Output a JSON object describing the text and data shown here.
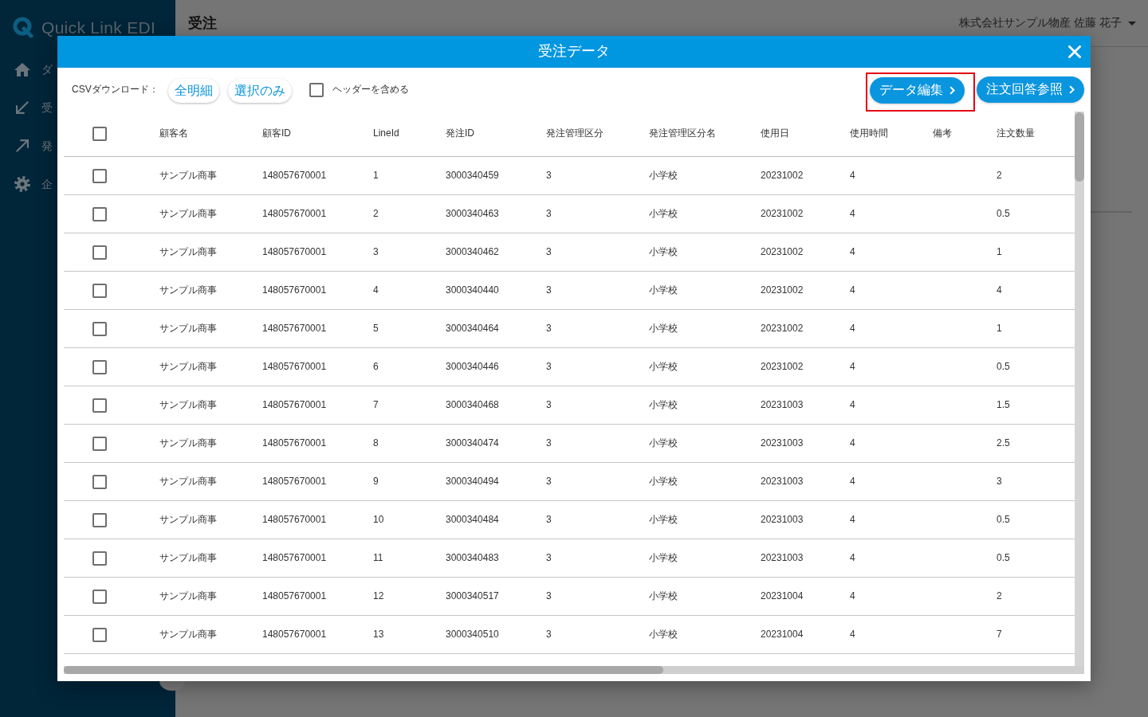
{
  "sidebar": {
    "logo": "Quick Link EDI",
    "items": [
      {
        "kind": "home",
        "label": "ダ"
      },
      {
        "kind": "inbound",
        "label": "受"
      },
      {
        "kind": "outbound",
        "label": "発"
      },
      {
        "kind": "settings",
        "label": "企"
      }
    ]
  },
  "header": {
    "title": "受注",
    "user": "株式会社サンプル物産 佐藤 花子"
  },
  "dialog": {
    "title": "受注データ",
    "csv_download": {
      "label": "CSVダウンロード：",
      "buttons": [
        "全明細",
        "選択のみ"
      ],
      "include_header": {
        "label": "ヘッダーを含める",
        "checked": false
      }
    },
    "actions": [
      {
        "label": "データ編集",
        "highlighted": true
      },
      {
        "label": "注文回答参照",
        "highlighted": false
      }
    ],
    "table": {
      "select_all_checked": false,
      "columns": [
        "顧客名",
        "顧客ID",
        "LineId",
        "発注ID",
        "発注管理区分",
        "発注管理区分名",
        "使用日",
        "使用時間",
        "備考",
        "注文数量"
      ],
      "rows": [
        {
          "selected": false,
          "customer_name": "サンプル商事",
          "customer_id": "148057670001",
          "line_id": "1",
          "order_id": "3000340459",
          "order_class": "3",
          "order_class_name": "小学校",
          "use_date": "20231002",
          "use_time": "4",
          "quantity": "2"
        },
        {
          "selected": false,
          "customer_name": "サンプル商事",
          "customer_id": "148057670001",
          "line_id": "2",
          "order_id": "3000340463",
          "order_class": "3",
          "order_class_name": "小学校",
          "use_date": "20231002",
          "use_time": "4",
          "quantity": "0.5"
        },
        {
          "selected": false,
          "customer_name": "サンプル商事",
          "customer_id": "148057670001",
          "line_id": "3",
          "order_id": "3000340462",
          "order_class": "3",
          "order_class_name": "小学校",
          "use_date": "20231002",
          "use_time": "4",
          "quantity": "1"
        },
        {
          "selected": false,
          "customer_name": "サンプル商事",
          "customer_id": "148057670001",
          "line_id": "4",
          "order_id": "3000340440",
          "order_class": "3",
          "order_class_name": "小学校",
          "use_date": "20231002",
          "use_time": "4",
          "quantity": "4"
        },
        {
          "selected": false,
          "customer_name": "サンプル商事",
          "customer_id": "148057670001",
          "line_id": "5",
          "order_id": "3000340464",
          "order_class": "3",
          "order_class_name": "小学校",
          "use_date": "20231002",
          "use_time": "4",
          "quantity": "1"
        },
        {
          "selected": false,
          "customer_name": "サンプル商事",
          "customer_id": "148057670001",
          "line_id": "6",
          "order_id": "3000340446",
          "order_class": "3",
          "order_class_name": "小学校",
          "use_date": "20231002",
          "use_time": "4",
          "quantity": "0.5"
        },
        {
          "selected": false,
          "customer_name": "サンプル商事",
          "customer_id": "148057670001",
          "line_id": "7",
          "order_id": "3000340468",
          "order_class": "3",
          "order_class_name": "小学校",
          "use_date": "20231003",
          "use_time": "4",
          "quantity": "1.5"
        },
        {
          "selected": false,
          "customer_name": "サンプル商事",
          "customer_id": "148057670001",
          "line_id": "8",
          "order_id": "3000340474",
          "order_class": "3",
          "order_class_name": "小学校",
          "use_date": "20231003",
          "use_time": "4",
          "quantity": "2.5"
        },
        {
          "selected": false,
          "customer_name": "サンプル商事",
          "customer_id": "148057670001",
          "line_id": "9",
          "order_id": "3000340494",
          "order_class": "3",
          "order_class_name": "小学校",
          "use_date": "20231003",
          "use_time": "4",
          "quantity": "3"
        },
        {
          "selected": false,
          "customer_name": "サンプル商事",
          "customer_id": "148057670001",
          "line_id": "10",
          "order_id": "3000340484",
          "order_class": "3",
          "order_class_name": "小学校",
          "use_date": "20231003",
          "use_time": "4",
          "quantity": "0.5"
        },
        {
          "selected": false,
          "customer_name": "サンプル商事",
          "customer_id": "148057670001",
          "line_id": "11",
          "order_id": "3000340483",
          "order_class": "3",
          "order_class_name": "小学校",
          "use_date": "20231003",
          "use_time": "4",
          "quantity": "0.5"
        },
        {
          "selected": false,
          "customer_name": "サンプル商事",
          "customer_id": "148057670001",
          "line_id": "12",
          "order_id": "3000340517",
          "order_class": "3",
          "order_class_name": "小学校",
          "use_date": "20231004",
          "use_time": "4",
          "quantity": "2"
        },
        {
          "selected": false,
          "customer_name": "サンプル商事",
          "customer_id": "148057670001",
          "line_id": "13",
          "order_id": "3000340510",
          "order_class": "3",
          "order_class_name": "小学校",
          "use_date": "20231004",
          "use_time": "4",
          "quantity": "7"
        }
      ]
    }
  }
}
